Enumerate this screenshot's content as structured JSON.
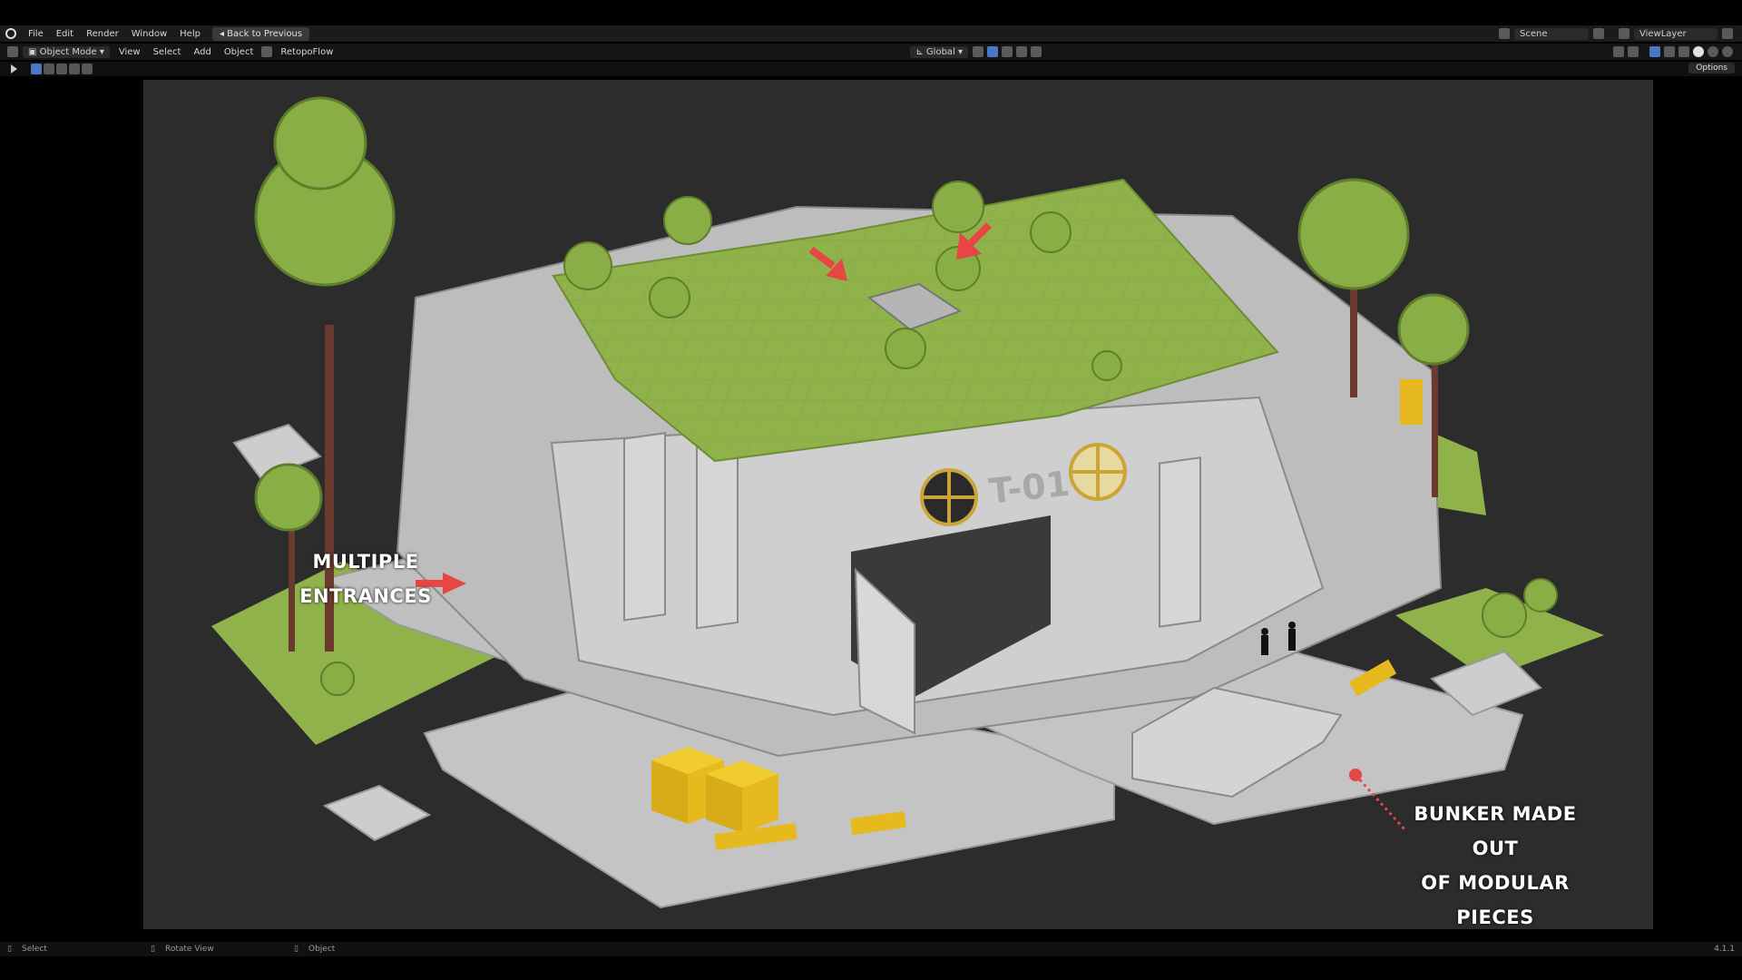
{
  "menu": {
    "items": [
      "File",
      "Edit",
      "Render",
      "Window",
      "Help"
    ],
    "back_button": "Back to Previous",
    "scene_label": "Scene",
    "viewlayer_label": "ViewLayer"
  },
  "header": {
    "mode": "Object Mode",
    "menus": [
      "View",
      "Select",
      "Add",
      "Object"
    ],
    "addon": "RetopoFlow",
    "transform_orientation": "Global",
    "options": "Options"
  },
  "viewport": {
    "bunker_sign": "T-01",
    "annotation_entrances": [
      "MULTIPLE",
      "ENTRANCES"
    ],
    "annotation_modular": [
      "BUNKER MADE OUT",
      "OF MODULAR PIECES"
    ]
  },
  "statusbar": {
    "select": "Select",
    "rotate": "Rotate View",
    "object": "Object",
    "version": "4.1.1"
  },
  "colors": {
    "grass": "#8fb24a",
    "concrete": "#c9c9c9",
    "accent_arrow": "#e84545",
    "crate": "#e6b91e",
    "background": "#2c2c2c"
  }
}
